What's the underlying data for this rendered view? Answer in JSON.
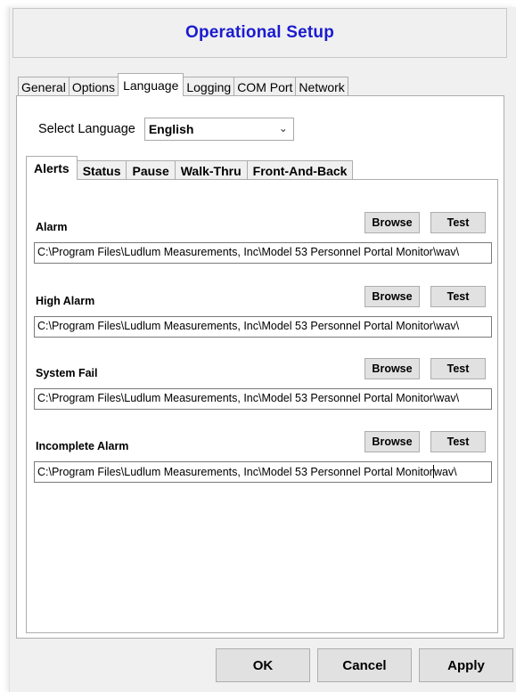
{
  "window": {
    "title": "Operational Setup"
  },
  "main_tabs": [
    {
      "label": "General",
      "selected": false
    },
    {
      "label": "Options",
      "selected": false
    },
    {
      "label": "Language",
      "selected": true
    },
    {
      "label": "Logging",
      "selected": false
    },
    {
      "label": "COM Port",
      "selected": false
    },
    {
      "label": "Network",
      "selected": false
    }
  ],
  "language": {
    "label": "Select Language",
    "selected": "English",
    "dropdown_icon": "chevron-down-icon"
  },
  "sub_tabs": [
    {
      "label": "Alerts",
      "selected": true
    },
    {
      "label": "Status",
      "selected": false
    },
    {
      "label": "Pause",
      "selected": false
    },
    {
      "label": "Walk-Thru",
      "selected": false
    },
    {
      "label": "Front-And-Back",
      "selected": false
    }
  ],
  "alerts": [
    {
      "label": "Alarm",
      "browse": "Browse",
      "test": "Test",
      "path": "C:\\Program Files\\Ludlum Measurements, Inc\\Model 53 Personnel Portal Monitor\\wav\\"
    },
    {
      "label": "High Alarm",
      "browse": "Browse",
      "test": "Test",
      "path": "C:\\Program Files\\Ludlum Measurements, Inc\\Model 53 Personnel Portal Monitor\\wav\\"
    },
    {
      "label": "System Fail",
      "browse": "Browse",
      "test": "Test",
      "path": "C:\\Program Files\\Ludlum Measurements, Inc\\Model 53 Personnel Portal Monitor\\wav\\"
    },
    {
      "label": "Incomplete Alarm",
      "browse": "Browse",
      "test": "Test",
      "path_before_caret": "C:\\Program Files\\Ludlum Measurements, Inc\\Model 53 Personnel Portal Monitor",
      "path_after_caret": "wav\\"
    }
  ],
  "footer": {
    "ok": "OK",
    "cancel": "Cancel",
    "apply": "Apply"
  },
  "colors": {
    "title": "#1b1bd0",
    "window_bg": "#f0f0f0",
    "button_bg": "#e1e1e1"
  }
}
